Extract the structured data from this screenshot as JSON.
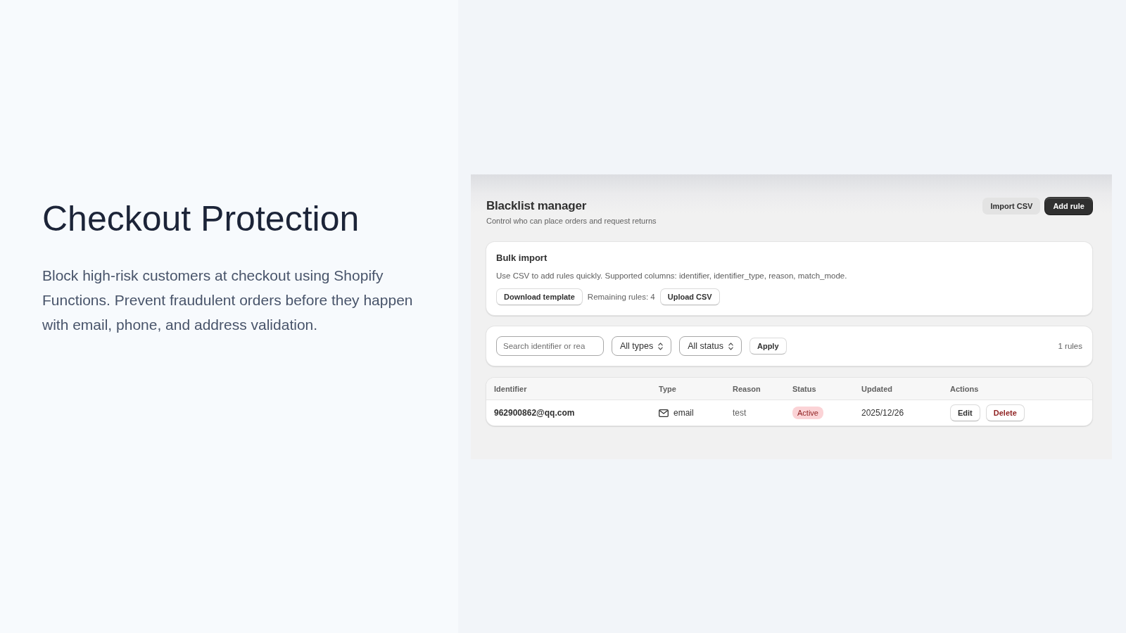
{
  "hero": {
    "title": "Checkout Protection",
    "description": "Block high-risk customers at checkout using Shopify Functions. Prevent fraudulent orders before they happen with email, phone, and address validation."
  },
  "app": {
    "title": "Blacklist manager",
    "subtitle": "Control who can place orders and request returns",
    "actions": [
      {
        "label": "Import CSV",
        "kind": "secondary"
      },
      {
        "label": "Add rule",
        "kind": "primary"
      }
    ],
    "bulk_import": {
      "title": "Bulk import",
      "description": "Use CSV to add rules quickly. Supported columns: identifier, identifier_type, reason, match_mode.",
      "items": [
        {
          "kind": "button",
          "label": "Download template"
        },
        {
          "kind": "text",
          "label": "Remaining rules: 4"
        },
        {
          "kind": "button",
          "label": "Upload CSV"
        }
      ]
    },
    "filters": {
      "search": {
        "placeholder": "Search identifier or rea"
      },
      "dropdowns": [
        {
          "value": "All types"
        },
        {
          "value": "All status"
        }
      ],
      "apply_button": "Apply",
      "count": "1 rules"
    },
    "table": {
      "columns": [
        "Identifier",
        "Type",
        "Reason",
        "Status",
        "Updated",
        "Actions"
      ],
      "rows": [
        {
          "identifier": "962900862@qq.com",
          "type": "email",
          "reason": "test",
          "status": "Active",
          "updated": "2025/12/26",
          "actions": [
            {
              "label": "Edit",
              "kind": "default"
            },
            {
              "label": "Delete",
              "kind": "destructive"
            }
          ]
        }
      ]
    }
  }
}
